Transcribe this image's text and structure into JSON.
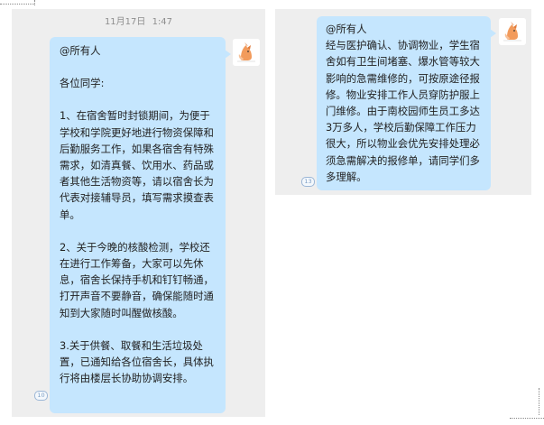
{
  "timestamp": {
    "date": "11月17日",
    "time": "1:47"
  },
  "left_message": {
    "mention": "@所有人",
    "greeting": "各位同学:",
    "item1": "1、在宿舍暂时封锁期间，为便于学校和学院更好地进行物资保障和后勤服务工作，如果各宿舍有特殊需求，如清真餐、饮用水、药品或者其他生活物资等，请以宿舍长为代表对接辅导员，填写需求摸查表单。",
    "item2": "2、关于今晚的核酸检测，学校还在进行工作筹备，大家可以先休息，宿舍长保持手机和钉钉畅通，打开声音不要静音，确保能随时通知到大家随时叫醒做核酸。",
    "item3": "3.关于供餐、取餐和生活垃圾处置，已通知给各位宿舍长，具体执行将由楼层长协助协调安排。",
    "read_count": "10"
  },
  "right_message": {
    "mention": "@所有人",
    "body": "经与医护确认、协调物业，学生宿舍如有卫生间堵塞、爆水管等较大影响的急需维修的，可按原途径报修。物业安排工作人员穿防护服上门维修。由于南校园师生员工多达3万多人，学校后勤保障工作压力很大，所以物业会优先安排处理必须急需解决的报修单，请同学们多多理解。",
    "read_count": "13"
  },
  "colors": {
    "bubble": "#c5e6fe",
    "panel_bg": "#eeeeee",
    "timestamp": "#8e8e8e"
  },
  "icons": {
    "avatar": "fox-avatar-icon",
    "read_receipt": "read-count-badge-icon"
  }
}
